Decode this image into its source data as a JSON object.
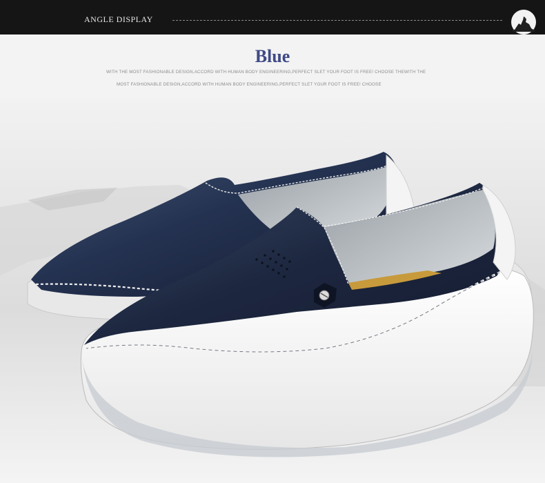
{
  "header": {
    "label": "ANGLE DISPLAY",
    "logo_icon": "wolf-moon-logo-icon"
  },
  "product": {
    "color_title": "Blue",
    "description_line_1": "WITH THE MOST FASHIONABLE DESIGN,ACCORD WITH HUMAN BODY ENGINEERING,PERFECT SLET YOUR FOOT IS FREE! CHOOSE THEWITH THE",
    "description_line_2": "MOST FASHIONABLE DESIGN,ACCORD WITH HUMAN BODY ENGINEERING,PERFECT SLET YOUR FOOT IS FREE! CHOOSE"
  },
  "colors": {
    "header_background": "#151515",
    "title_color": "#3f4a86",
    "shoe_upper": "#1f2a44",
    "shoe_sole": "#ffffff"
  }
}
